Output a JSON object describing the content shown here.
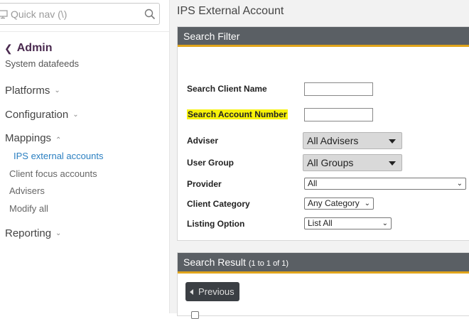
{
  "sidebar": {
    "quicknav_placeholder": "Quick nav (\\)",
    "admin_label": "Admin",
    "subtitle": "System datafeeds",
    "sections": {
      "platforms": "Platforms",
      "configuration": "Configuration",
      "mappings": "Mappings",
      "reporting": "Reporting"
    },
    "mapping_items": {
      "ips": "IPS external accounts",
      "client_focus": "Client focus accounts",
      "advisers": "Advisers",
      "modify": "Modify all"
    }
  },
  "main": {
    "title": "IPS External Account",
    "filter": {
      "heading": "Search Filter",
      "labels": {
        "client_name": "Search Client Name",
        "account_number": "Search Account Number",
        "adviser": "Adviser",
        "user_group": "User Group",
        "provider": "Provider",
        "client_category": "Client Category",
        "listing_option": "Listing Option"
      },
      "values": {
        "client_name": "",
        "account_number": "",
        "adviser": "All Advisers",
        "user_group": "All Groups",
        "provider": "All",
        "client_category": "Any Category",
        "listing_option": "List All"
      }
    },
    "result": {
      "heading": "Search Result",
      "count": "(1 to 1 of 1)",
      "previous_label": "Previous"
    }
  },
  "colors": {
    "panel_header": "#5a5f64",
    "accent_underline": "#e0a41b",
    "highlight": "#f7f20a",
    "active_link": "#2a7fc1",
    "admin_title": "#4a2a4f"
  }
}
